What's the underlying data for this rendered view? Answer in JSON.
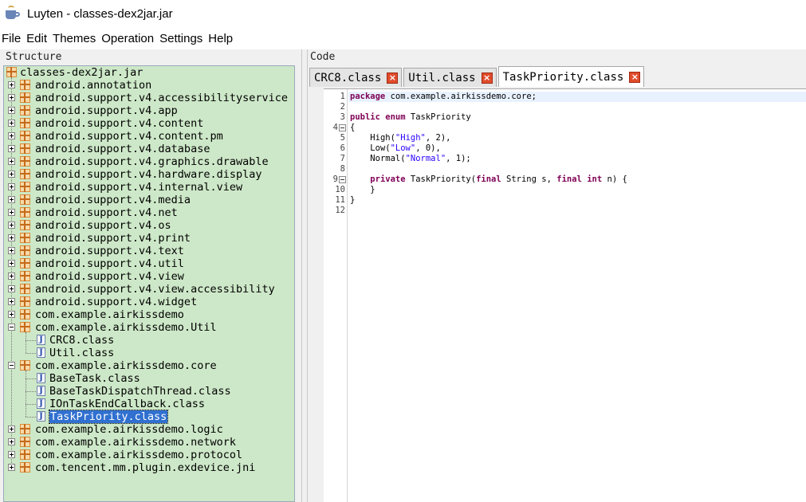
{
  "window": {
    "title": "Luyten - classes-dex2jar.jar"
  },
  "menu": [
    "File",
    "Edit",
    "Themes",
    "Operation",
    "Settings",
    "Help"
  ],
  "structure": {
    "header": "Structure",
    "root": "classes-dex2jar.jar",
    "packages_before": [
      "android.annotation",
      "android.support.v4.accessibilityservice",
      "android.support.v4.app",
      "android.support.v4.content",
      "android.support.v4.content.pm",
      "android.support.v4.database",
      "android.support.v4.graphics.drawable",
      "android.support.v4.hardware.display",
      "android.support.v4.internal.view",
      "android.support.v4.media",
      "android.support.v4.net",
      "android.support.v4.os",
      "android.support.v4.print",
      "android.support.v4.text",
      "android.support.v4.util",
      "android.support.v4.view",
      "android.support.v4.view.accessibility",
      "android.support.v4.widget",
      "com.example.airkissdemo"
    ],
    "util_package": {
      "name": "com.example.airkissdemo.Util",
      "classes": [
        "CRC8.class",
        "Util.class"
      ]
    },
    "core_package": {
      "name": "com.example.airkissdemo.core",
      "classes": [
        "BaseTask.class",
        "BaseTaskDispatchThread.class",
        "IOnTaskEndCallback.class",
        "TaskPriority.class"
      ],
      "selected": "TaskPriority.class"
    },
    "packages_after": [
      "com.example.airkissdemo.logic",
      "com.example.airkissdemo.network",
      "com.example.airkissdemo.protocol",
      "com.tencent.mm.plugin.exdevice.jni"
    ]
  },
  "code": {
    "header": "Code",
    "tabs": [
      {
        "label": "CRC8.class",
        "active": false
      },
      {
        "label": "Util.class",
        "active": false
      },
      {
        "label": "TaskPriority.class",
        "active": true
      }
    ],
    "close_glyph": "×",
    "line_numbers": [
      "1",
      "2",
      "3",
      "4",
      "5",
      "6",
      "7",
      "8",
      "9",
      "10",
      "11",
      "12"
    ],
    "lines": [
      "package com.example.airkissdemo.core;",
      "",
      "public enum TaskPriority",
      "{",
      "    High(\"High\", 2),",
      "    Low(\"Low\", 0),",
      "    Normal(\"Normal\", 1);",
      "",
      "    private TaskPriority(final String s, final int n) {",
      "    }",
      "}",
      ""
    ],
    "fold_lines": [
      "4",
      "9"
    ]
  }
}
